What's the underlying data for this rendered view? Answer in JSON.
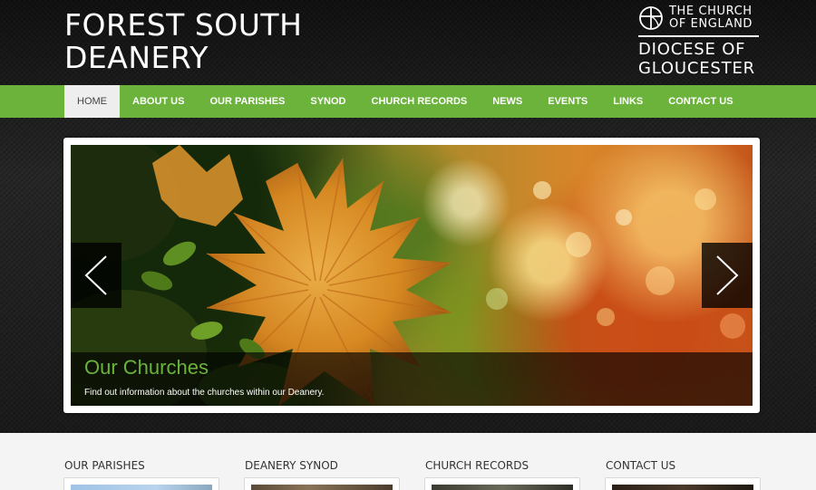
{
  "header": {
    "title_line1": "FOREST SOUTH",
    "title_line2": "DEANERY",
    "coe_line1": "THE CHURCH",
    "coe_line2": "OF ENGLAND",
    "diocese_line1": "DIOCESE OF",
    "diocese_line2": "GLOUCESTER"
  },
  "nav": {
    "items": [
      {
        "label": "HOME",
        "active": true
      },
      {
        "label": "ABOUT US"
      },
      {
        "label": "OUR PARISHES"
      },
      {
        "label": "SYNOD"
      },
      {
        "label": "CHURCH RECORDS"
      },
      {
        "label": "NEWS"
      },
      {
        "label": "EVENTS"
      },
      {
        "label": "LINKS"
      },
      {
        "label": "CONTACT US"
      }
    ]
  },
  "slider": {
    "caption_title": "Our Churches",
    "caption_text": "Find out information about the churches within our Deanery.",
    "prev_icon": "chevron-left-icon",
    "next_icon": "chevron-right-icon"
  },
  "columns": [
    {
      "title": "OUR PARISHES"
    },
    {
      "title": "DEANERY SYNOD"
    },
    {
      "title": "CHURCH RECORDS"
    },
    {
      "title": "CONTACT US"
    }
  ],
  "colors": {
    "accent_green": "#6bb33b",
    "header_dark": "#1e1e1e",
    "active_nav_bg": "#eeeeee"
  }
}
